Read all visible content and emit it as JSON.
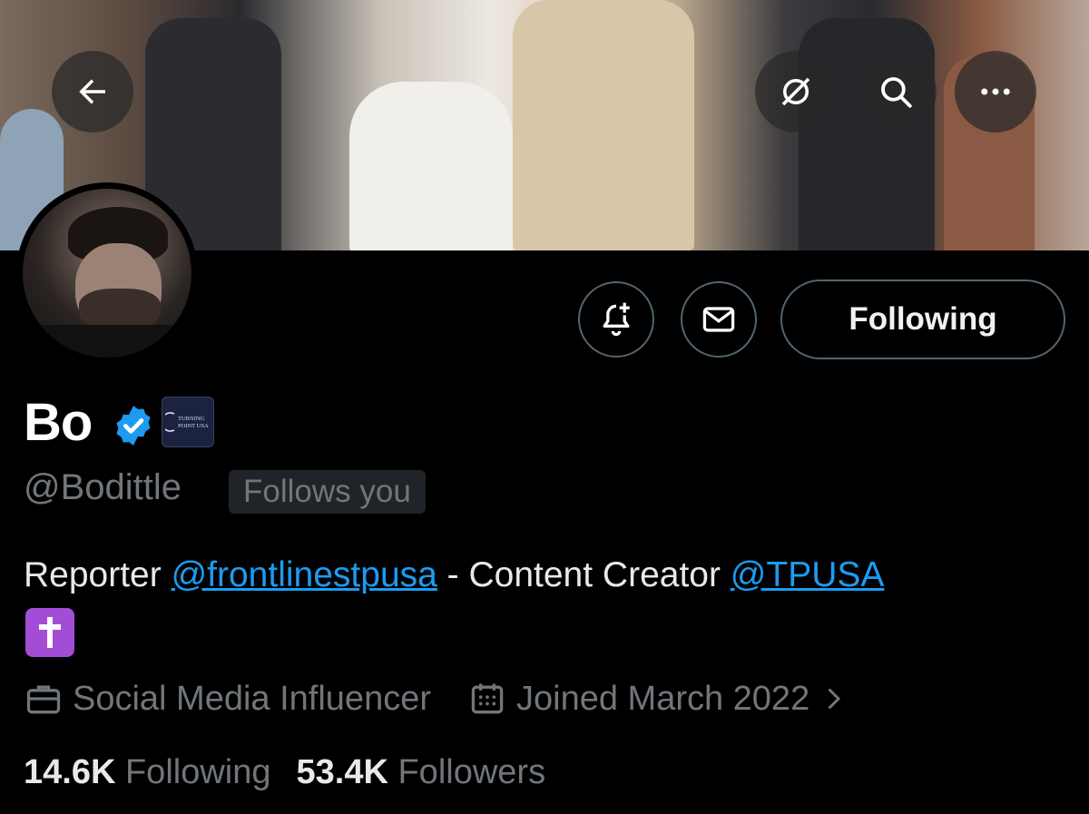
{
  "header": {
    "back_icon": "arrow-left-icon",
    "grok_icon": "grok-icon",
    "search_icon": "search-icon",
    "more_icon": "more-dots-icon"
  },
  "actions": {
    "notify_icon": "bell-plus-icon",
    "message_icon": "envelope-icon",
    "following_label": "Following"
  },
  "profile": {
    "name": "Bo",
    "verified_icon": "verified-badge-icon",
    "affiliation_badge_text": "TURNING POINT USA",
    "handle": "@Bodittle",
    "follows_you": "Follows you",
    "bio": {
      "part1": "Reporter ",
      "link1": "@frontlinestpusa",
      "part2": " - Content Creator ",
      "link2": "@TPUSA",
      "emoji": "✝️"
    },
    "category": "Social Media Influencer",
    "joined": "Joined March 2022",
    "following_count": "14.6K",
    "following_label": "Following",
    "followers_count": "53.4K",
    "followers_label": "Followers"
  },
  "colors": {
    "background": "#000000",
    "link": "#1d9bf0",
    "muted": "#71767b",
    "border": "#536471",
    "verified": "#1d9bf0"
  }
}
